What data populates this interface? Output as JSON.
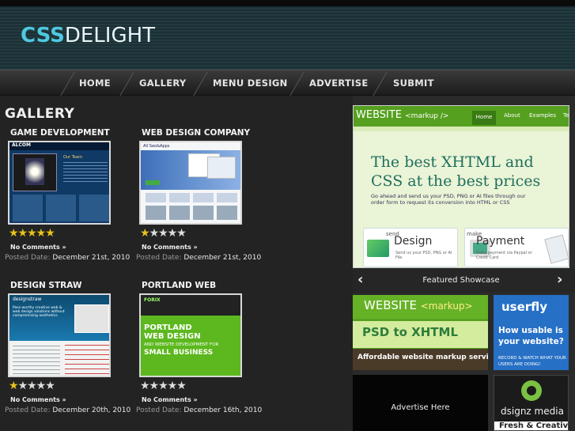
{
  "brand": {
    "logo_part1": "CSS",
    "logo_part2": "DELIGHT"
  },
  "nav": [
    "HOME",
    "GALLERY",
    "MENU DESIGN",
    "ADVERTISE",
    "SUBMIT"
  ],
  "gallery_title": "GALLERY",
  "posts": [
    {
      "title": "GAME DEVELOPMENT",
      "rating": 5,
      "comments": "No Comments »",
      "date_label": "Posted Date:",
      "date": "December 21st, 2010",
      "thumb": {
        "logo": "ALCOM",
        "heading": "Our Team"
      }
    },
    {
      "title": "WEB DESIGN COMPANY",
      "rating": 1,
      "comments": "No Comments »",
      "date_label": "Posted Date:",
      "date": "December 21st, 2010",
      "thumb": {
        "logo": "All Seo&Apps"
      }
    },
    {
      "title": "DESIGN STRAW",
      "rating": 1,
      "comments": "No Comments »",
      "date_label": "Posted Date:",
      "date": "December 20th, 2010",
      "thumb": {
        "logo": "designstraw",
        "tagline": "Pass-worthy creative web & web design solutions without compromising aesthetics."
      }
    },
    {
      "title": "PORTLAND WEB",
      "rating": 0,
      "comments": "No Comments »",
      "date_label": "Posted Date:",
      "date": "December 16th, 2010",
      "thumb": {
        "logo": "FORIX",
        "line1": "PORTLAND",
        "line2": "WEB DESIGN",
        "line3": "AND WEBSITE DEVELOPMENT FOR",
        "line4": "SMALL BUSINESS"
      }
    }
  ],
  "featured": {
    "logo": "WEBSITE",
    "logo_sub": "<markup />",
    "tabs": [
      "Home",
      "About",
      "Examples",
      "Te"
    ],
    "headline1": "The best XHTML and",
    "headline2": "CSS at the best prices",
    "body": "Go ahead and send us your PSD, PNG or AI files through our order form to request its conversion into HTML or CSS",
    "card1_small": "send",
    "card1_big": "Design",
    "card1_note": "Send us your PSD, PNG or AI File",
    "card2_small": "make",
    "card2_big": "Payment",
    "card2_note": "Make payment via Paypal or Credit Card",
    "caption": "Featured Showcase"
  },
  "ads": {
    "website_markup": {
      "logo": "WEBSITE",
      "sub": "<markup>",
      "mid": "PSD to XHTML",
      "bottom": "Affordable website markup service"
    },
    "userfly": {
      "logo": "userfly",
      "question": "How usable is your website?",
      "note": "RECORD & WATCH WHAT YOUR USERS ARE DOING!"
    },
    "advertise": "Advertise Here",
    "dsignz": {
      "logo": "dsignz media",
      "bottom": "Fresh & Creative"
    }
  }
}
